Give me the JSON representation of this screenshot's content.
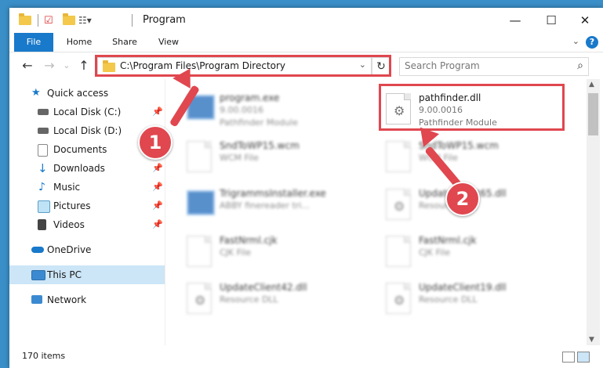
{
  "window": {
    "title": "Program"
  },
  "ribbon": {
    "tabs": [
      "File",
      "Home",
      "Share",
      "View"
    ],
    "help": "?"
  },
  "address": {
    "path": "C:\\Program Files\\Program Directory"
  },
  "search": {
    "placeholder": "Search Program"
  },
  "nav": {
    "items": [
      {
        "label": "Quick access",
        "icon": "star-icon",
        "pinned": false
      },
      {
        "label": "Local Disk (C:)",
        "icon": "drive-icon",
        "pinned": true
      },
      {
        "label": "Local Disk (D:)",
        "icon": "drive-icon",
        "pinned": false
      },
      {
        "label": "Documents",
        "icon": "documents-icon",
        "pinned": true
      },
      {
        "label": "Downloads",
        "icon": "download-icon",
        "pinned": true
      },
      {
        "label": "Music",
        "icon": "music-icon",
        "pinned": true
      },
      {
        "label": "Pictures",
        "icon": "pictures-icon",
        "pinned": true
      },
      {
        "label": "Videos",
        "icon": "videos-icon",
        "pinned": true
      },
      {
        "label": "OneDrive",
        "icon": "cloud-icon",
        "pinned": false
      },
      {
        "label": "This PC",
        "icon": "computer-icon",
        "pinned": false,
        "selected": true
      },
      {
        "label": "Network",
        "icon": "network-icon",
        "pinned": false
      }
    ]
  },
  "files": [
    {
      "name": "program.exe",
      "meta1": "9.00.0016",
      "meta2": "Pathfinder Module",
      "blurred": true,
      "icon": "exe-icon"
    },
    {
      "name": "pathfinder.dll",
      "meta1": "9.00.0016",
      "meta2": "Pathfinder Module",
      "blurred": false,
      "icon": "dll-icon"
    },
    {
      "name": "SndToWP15.wcm",
      "meta1": "WCM File",
      "blurred": true
    },
    {
      "name": "SndToWP15.wcm",
      "meta1": "WCM File",
      "blurred": true
    },
    {
      "name": "TrigrammsInstaller.exe",
      "meta1": "ABBY finereader tri...",
      "blurred": true,
      "icon": "exe-icon"
    },
    {
      "name": "UpdateClient65.dll",
      "meta1": "Resource DLL",
      "blurred": true
    },
    {
      "name": "FastNrml.cjk",
      "meta1": "CJK File",
      "blurred": true
    },
    {
      "name": "FastNrml.cjk",
      "meta1": "CJK File",
      "blurred": true
    },
    {
      "name": "UpdateClient42.dll",
      "meta1": "Resource DLL",
      "blurred": true
    },
    {
      "name": "UpdateClient19.dll",
      "meta1": "Resource DLL",
      "blurred": true
    }
  ],
  "status": {
    "count": "170 items"
  },
  "annotations": {
    "callout1": "1",
    "callout2": "2",
    "color": "#e0474f"
  },
  "colors": {
    "accent": "#1979ca",
    "selected": "#cce5f7"
  }
}
